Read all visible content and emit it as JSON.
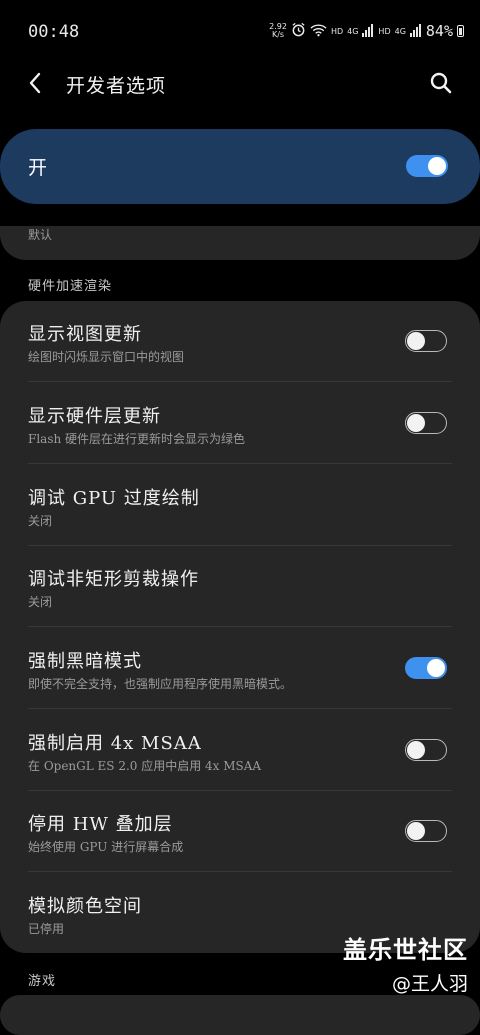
{
  "status_bar": {
    "time": "00:48",
    "net_speed_value": "2.92",
    "net_speed_unit": "K/s",
    "hd1": "HD",
    "sig1": "4G",
    "hd2": "HD",
    "sig2": "4G",
    "battery": "84%"
  },
  "app_bar": {
    "title": "开发者选项"
  },
  "master_toggle": {
    "label": "开",
    "on": true
  },
  "previous_item": {
    "summary": "默认"
  },
  "section_hw": {
    "header": "硬件加速渲染"
  },
  "settings": [
    {
      "title": "显示视图更新",
      "summary": "绘图时闪烁显示窗口中的视图",
      "switch": "off"
    },
    {
      "title": "显示硬件层更新",
      "summary": "Flash 硬件层在进行更新时会显示为绿色",
      "switch": "off"
    },
    {
      "title": "调试 GPU 过度绘制",
      "summary": "关闭",
      "switch": "none"
    },
    {
      "title": "调试非矩形剪裁操作",
      "summary": "关闭",
      "switch": "none"
    },
    {
      "title": "强制黑暗模式",
      "summary": "即使不完全支持，也强制应用程序使用黑暗模式。",
      "switch": "on"
    },
    {
      "title": "强制启用 4x MSAA",
      "summary": "在 OpenGL ES 2.0 应用中启用 4x MSAA",
      "switch": "off"
    },
    {
      "title": "停用 HW 叠加层",
      "summary": "始终使用 GPU 进行屏幕合成",
      "switch": "off"
    },
    {
      "title": "模拟颜色空间",
      "summary": "已停用",
      "switch": "none"
    }
  ],
  "section_game": {
    "header": "游戏"
  },
  "watermark": {
    "logo": "盖乐世社区",
    "user": "@王人羽"
  },
  "colors": {
    "accent": "#3e91ee",
    "master_card": "#1d3a5f",
    "card_bg": "#262626",
    "background": "#000000"
  }
}
